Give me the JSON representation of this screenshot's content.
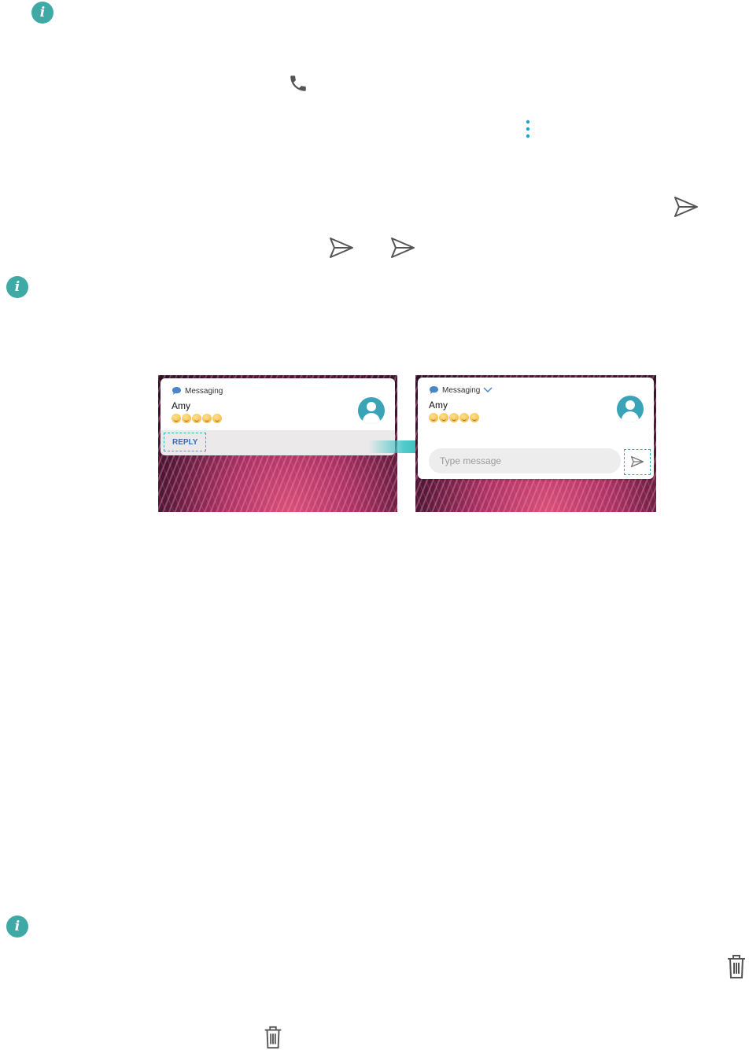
{
  "colors": {
    "accent": "#3fa9a6",
    "menu_dots": "#1ea0d8",
    "reply_label": "#3d6fb0",
    "highlight": "#2bb3b5",
    "icon_gray": "#555555"
  },
  "icons": {
    "info": "i",
    "info_icons": [
      "info-icon",
      "info-icon",
      "info-icon"
    ],
    "inline": [
      "phone-icon",
      "more-vert-icon",
      "send-icon",
      "send-icon",
      "send-icon",
      "trash-icon",
      "trash-icon"
    ]
  },
  "left_notification": {
    "app_name": "Messaging",
    "sender": "Amy",
    "emoji_count": 5,
    "reply_label": "REPLY"
  },
  "right_notification": {
    "app_name": "Messaging",
    "sender": "Amy",
    "emoji_count": 5,
    "input_placeholder": "Type message"
  }
}
